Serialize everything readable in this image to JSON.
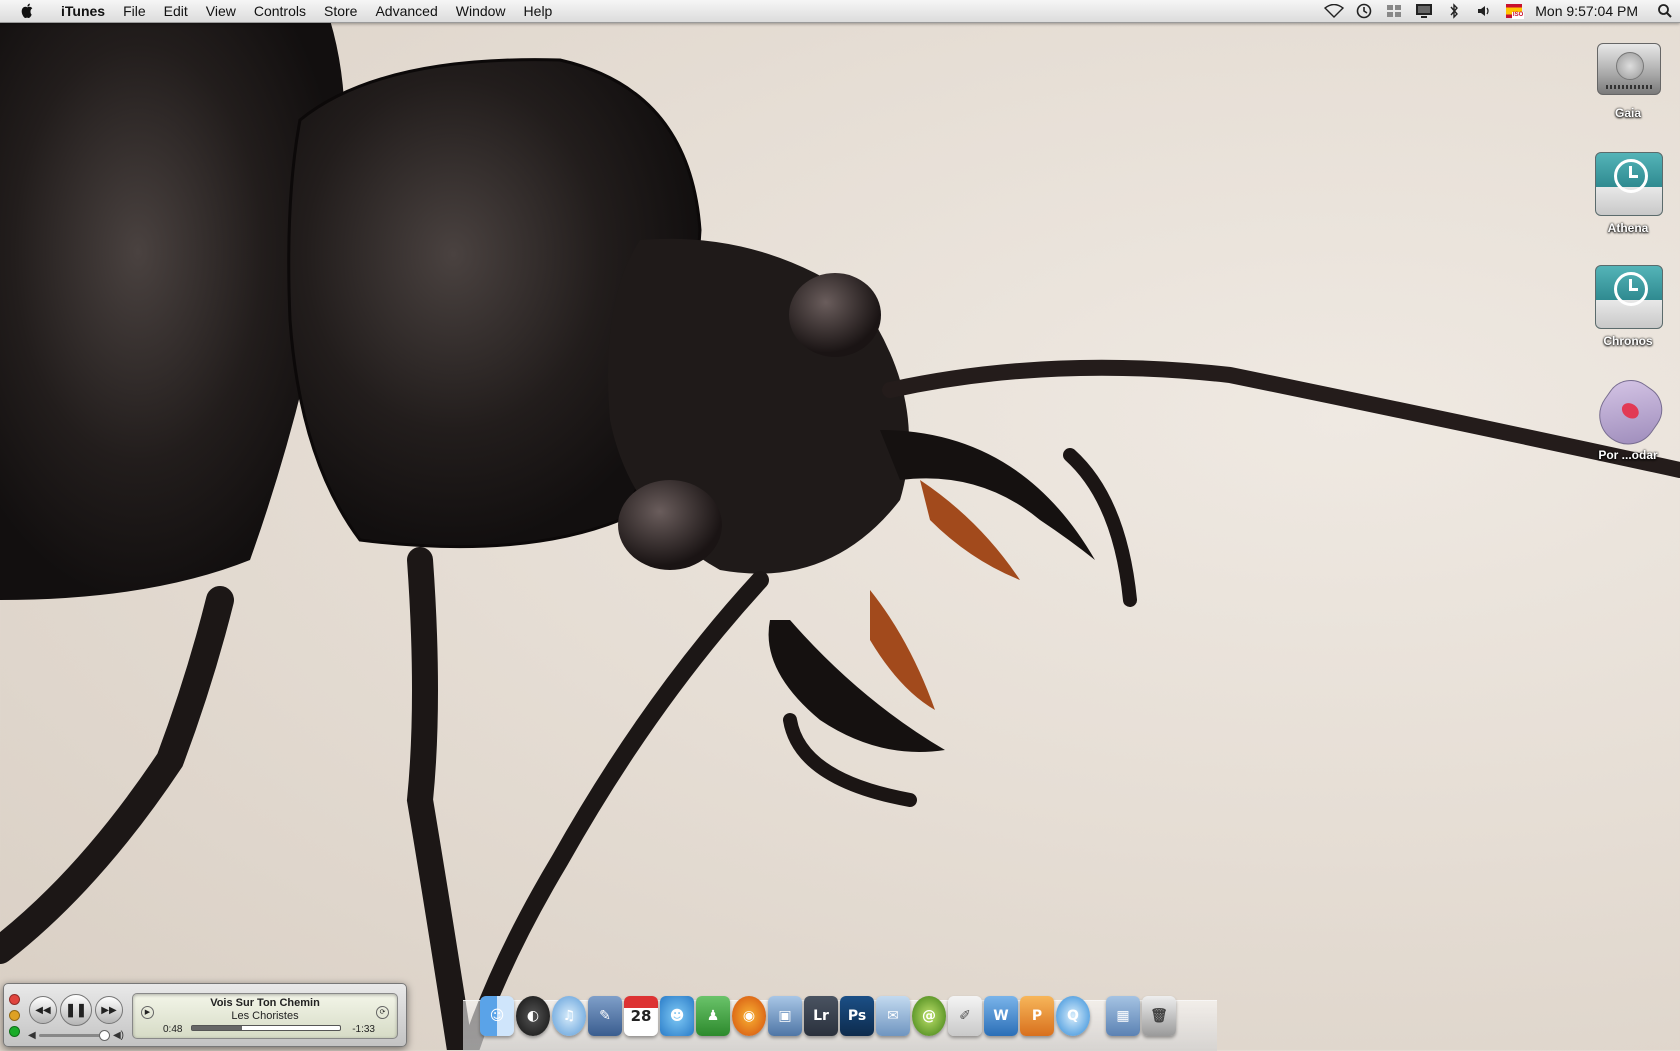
{
  "menubar": {
    "app_name": "iTunes",
    "menus": [
      "File",
      "Edit",
      "View",
      "Controls",
      "Store",
      "Advanced",
      "Window",
      "Help"
    ],
    "status_icons": [
      "wifi-icon",
      "time-machine-icon",
      "spaces-icon",
      "display-icon",
      "bluetooth-icon",
      "volume-icon",
      "input-source-flag-icon"
    ],
    "input_source_badge": "ISO",
    "clock": "Mon 9:57:04 PM"
  },
  "desktop": {
    "icons": [
      {
        "label": "Gaia",
        "icon": "hard-drive-icon"
      },
      {
        "label": "Athena",
        "icon": "time-machine-drive-icon"
      },
      {
        "label": "Chronos",
        "icon": "time-machine-drive-icon"
      },
      {
        "label": "Por ...odar",
        "icon": "mouse-pad-icon"
      }
    ]
  },
  "mini_player": {
    "song": "Vois Sur Ton Chemin",
    "artist": "Les Choristes",
    "elapsed": "0:48",
    "remaining": "-1:33",
    "progress": 0.34,
    "volume": 0.9,
    "controls": [
      "previous",
      "pause",
      "next"
    ]
  },
  "dock": {
    "apps": [
      "Finder",
      "Dashboard",
      "iTunes",
      "Preview",
      "iCal",
      "iChat",
      "Address",
      "Firefox",
      "iPhoto",
      "Lightroom",
      "Photoshop",
      "Mail",
      "Kindle",
      "Pages",
      "Word",
      "PowerPoint",
      "QuickTime"
    ],
    "ical_day": "28",
    "lightroom_label": "Lr",
    "photoshop_label": "Ps",
    "stack_apps": [
      "Applications",
      "Trash"
    ]
  },
  "colors": {
    "menubar_bg": "#e4e4e4",
    "wallpaper_bg": "#e6ded5",
    "beetle": "#1d1a19",
    "close_light": "#e0443e",
    "min_light": "#dea123",
    "zoom_light": "#1aac29"
  }
}
